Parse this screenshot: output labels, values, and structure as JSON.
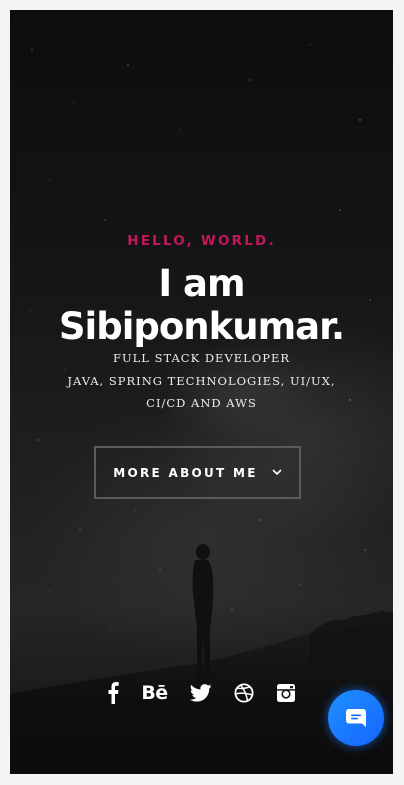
{
  "hero": {
    "greeting": "HELLO, WORLD.",
    "headline_line1": "I am",
    "headline_line2": "Sibiponkumar.",
    "subtitle_lines": [
      "FULL STACK DEVELOPER",
      "JAVA, SPRING TECHNOLOGIES, UI/UX,",
      "CI/CD AND AWS"
    ],
    "cta_label": "MORE ABOUT ME",
    "cta_icon": "chevron-down-icon"
  },
  "socials": [
    {
      "name": "facebook-icon"
    },
    {
      "name": "behance-icon",
      "glyph": "Bē"
    },
    {
      "name": "twitter-icon"
    },
    {
      "name": "dribbble-icon"
    },
    {
      "name": "instagram-icon"
    }
  ],
  "chat": {
    "icon": "chat-bubble-icon"
  },
  "colors": {
    "accent": "#c2185b",
    "background": "#141415",
    "text": "#ffffff",
    "chat_button": "#1565ff"
  }
}
